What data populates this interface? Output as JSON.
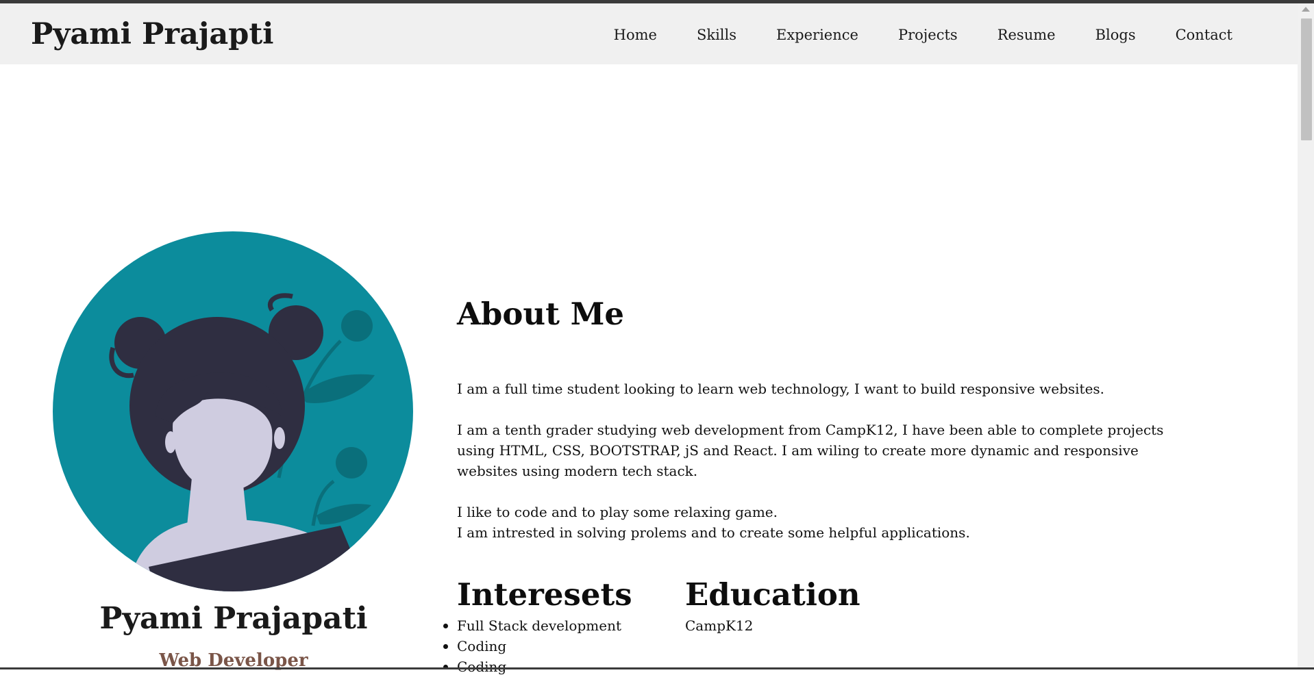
{
  "header": {
    "brand": "Pyami Prajapti",
    "nav": [
      "Home",
      "Skills",
      "Experience",
      "Projects",
      "Resume",
      "Blogs",
      "Contact"
    ]
  },
  "profile": {
    "name": "Pyami Prajapati",
    "role": "Web Developer",
    "avatar_colors": {
      "background": "#0c8c9c",
      "hair": "#2f2e41",
      "skin": "#cfcce0",
      "leaf": "#0a6f7b"
    }
  },
  "about": {
    "title": "About Me",
    "paragraphs": [
      "I am a full time student looking to learn web technology, I want to build responsive websites.",
      "I am a tenth grader studying web development from CampK12, I have been able to complete projects using HTML, CSS, BOOTSTRAP, jS and React. I am wiling to create more dynamic and responsive websites using modern tech stack.",
      "I like to code and to play some relaxing game.",
      "I am intrested in solving prolems and to create some helpful applications."
    ]
  },
  "interests": {
    "title": "Interesets",
    "items": [
      "Full Stack development",
      "Coding",
      "Coding"
    ]
  },
  "education": {
    "title": "Education",
    "items": [
      "CampK12"
    ]
  }
}
